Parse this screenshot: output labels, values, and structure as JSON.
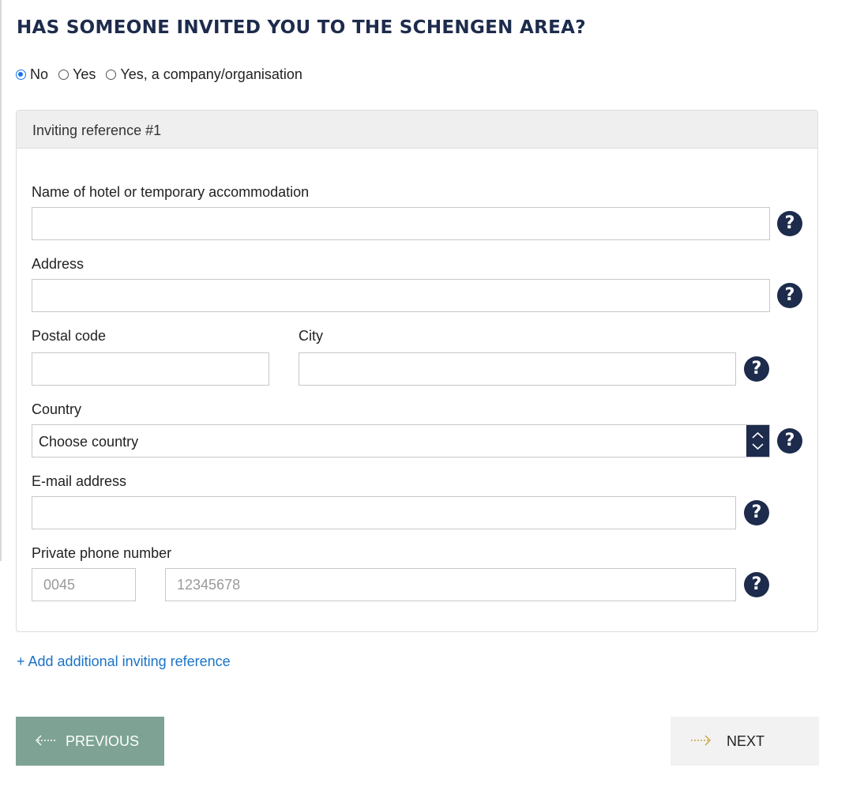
{
  "page": {
    "title": "HAS SOMEONE INVITED YOU TO THE SCHENGEN AREA?"
  },
  "invited_options": [
    {
      "label": "No",
      "selected": true
    },
    {
      "label": "Yes",
      "selected": false
    },
    {
      "label": "Yes, a company/organisation",
      "selected": false
    }
  ],
  "card": {
    "header": "Inviting reference #1",
    "hotel_label": "Name of hotel or temporary accommodation",
    "hotel_value": "",
    "address_label": "Address",
    "address_value": "",
    "postal_label": "Postal code",
    "postal_value": "",
    "city_label": "City",
    "city_value": "",
    "country_label": "Country",
    "country_selected": "Choose country",
    "email_label": "E-mail address",
    "email_value": "",
    "phone_label": "Private phone number",
    "phone_prefix_placeholder": "0045",
    "phone_number_placeholder": "12345678",
    "help_glyph": "?"
  },
  "add_link": "+ Add additional inviting reference",
  "nav": {
    "previous_label": "PREVIOUS",
    "next_label": "NEXT",
    "previous_icon": "arrow-left-dotted-icon",
    "next_icon": "arrow-right-dotted-icon"
  },
  "colors": {
    "title": "#1d2b4c",
    "help_icon": "#1d2b4c",
    "link": "#1a73c8",
    "previous_button": "#7ea394",
    "next_button": "#f2f2f2",
    "next_arrow": "#c9a13b"
  }
}
